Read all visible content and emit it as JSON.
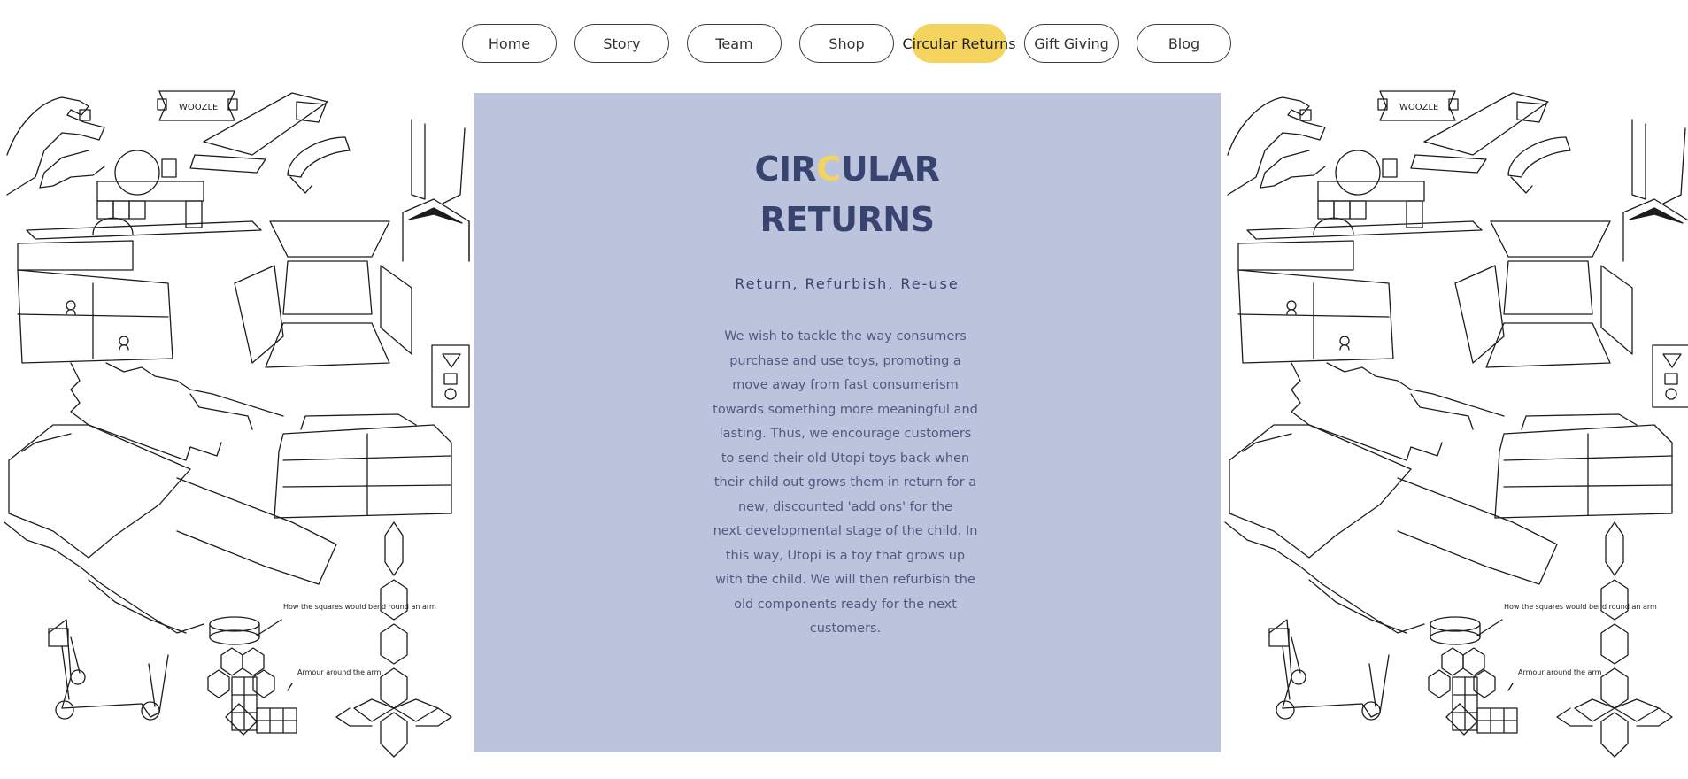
{
  "nav": {
    "items": [
      {
        "label": "Home",
        "active": false
      },
      {
        "label": "Story",
        "active": false
      },
      {
        "label": "Team",
        "active": false
      },
      {
        "label": "Shop",
        "active": false
      },
      {
        "label": "Circular Returns",
        "active": true
      },
      {
        "label": "Gift Giving",
        "active": false
      },
      {
        "label": "Blog",
        "active": false
      }
    ],
    "active_color": "#f4d35e"
  },
  "panel": {
    "background": "#bbc3dd",
    "title": {
      "line1_part1": "CIR",
      "line1_highlight": "C",
      "line1_part2": "ULAR",
      "line2": "RETURNS"
    },
    "title_color": "#38436f",
    "subtitle": "Return, Refurbish, Re-use",
    "body": [
      "We wish to tackle the way consumers purchase and use toys, promoting a move away from fast  consumerism towards something more meaningful and lasting. Thus, we encourage customers to send their old Utopi toys back when their child out grows them in return for a new, discounted 'add ons' for the",
      "next developmental stage of the child. In this way, Utopi is a toy that grows up with the child. We will then refurbish the old components ready for the next customers."
    ]
  },
  "illustration": {
    "sign_text": "WOOZLE",
    "note_squares": "How the squares would bend round an arm",
    "note_armour": "Armour around the arm"
  }
}
